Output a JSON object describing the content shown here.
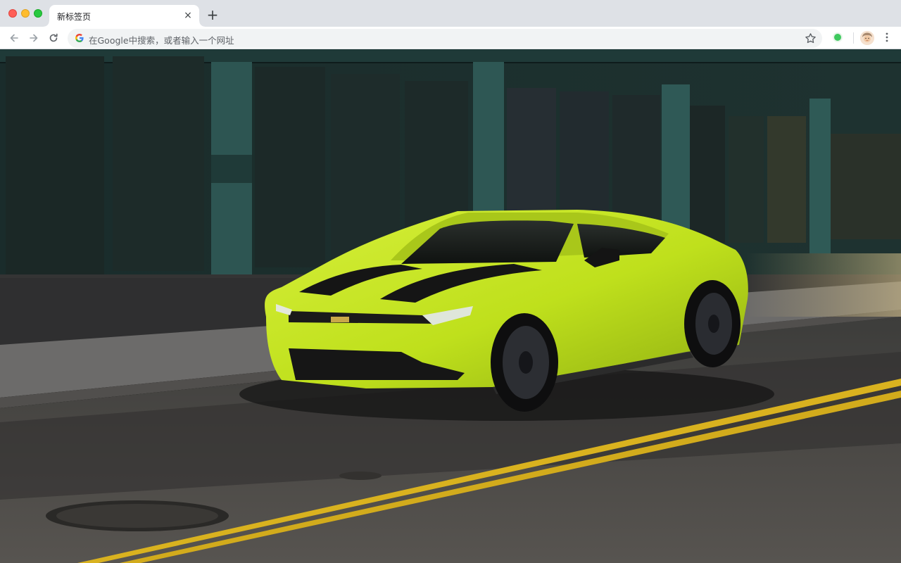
{
  "window": {
    "tab": {
      "title": "新标签页",
      "close_glyph": "×"
    },
    "new_tab_glyph": "+"
  },
  "toolbar": {
    "back_icon": "arrow-left-icon",
    "forward_icon": "arrow-right-icon",
    "reload_icon": "reload-icon",
    "omnibox": {
      "placeholder": "在Google中搜索，或者输入一个网址",
      "icon": "google-g-icon"
    },
    "bookmark_icon": "star-icon",
    "extension_icon": "green-circle-extension-icon",
    "profile_icon": "avatar",
    "menu_icon": "vertical-dots-icon"
  },
  "colors": {
    "chrome_bg": "#dee1e6",
    "omnibox_bg": "#f1f3f4",
    "car_body": "#c8e61e",
    "road_line": "#d9b21f"
  },
  "wallpaper": {
    "subject": "lime-green sports coupe parked on street",
    "background": "teal industrial building facade"
  }
}
